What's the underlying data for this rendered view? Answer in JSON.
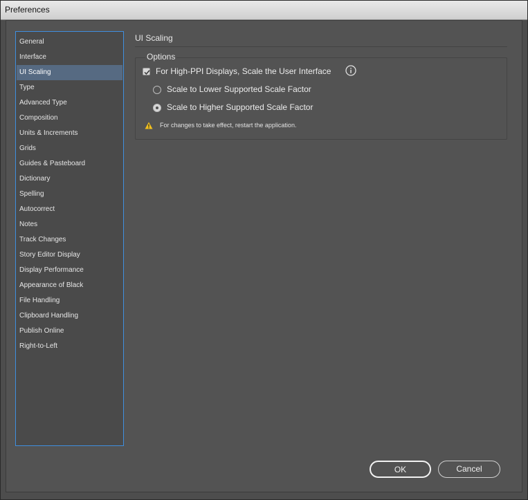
{
  "window": {
    "title": "Preferences"
  },
  "sidebar": {
    "items": [
      {
        "label": "General"
      },
      {
        "label": "Interface"
      },
      {
        "label": "UI Scaling",
        "selected": true
      },
      {
        "label": "Type"
      },
      {
        "label": "Advanced Type"
      },
      {
        "label": "Composition"
      },
      {
        "label": "Units & Increments"
      },
      {
        "label": "Grids"
      },
      {
        "label": "Guides & Pasteboard"
      },
      {
        "label": "Dictionary"
      },
      {
        "label": "Spelling"
      },
      {
        "label": "Autocorrect"
      },
      {
        "label": "Notes"
      },
      {
        "label": "Track Changes"
      },
      {
        "label": "Story Editor Display"
      },
      {
        "label": "Display Performance"
      },
      {
        "label": "Appearance of Black"
      },
      {
        "label": "File Handling"
      },
      {
        "label": "Clipboard Handling"
      },
      {
        "label": "Publish Online"
      },
      {
        "label": "Right-to-Left"
      }
    ]
  },
  "main": {
    "section_title": "UI Scaling",
    "options_legend": "Options",
    "scale_ui_checkbox": {
      "label": "For High-PPI Displays, Scale the User Interface",
      "checked": true
    },
    "radio_lower": {
      "label": "Scale to Lower Supported Scale Factor",
      "checked": false
    },
    "radio_higher": {
      "label": "Scale to Higher Supported Scale Factor",
      "checked": true
    },
    "warning_text": "For changes to take effect, restart the application."
  },
  "buttons": {
    "ok": "OK",
    "cancel": "Cancel"
  },
  "icons": {
    "info": "info-icon",
    "warning": "warning-icon",
    "checkmark": "checkmark-icon"
  },
  "colors": {
    "accent": "#3f8fe0",
    "selected_item": "#566a82",
    "warning": "#f2c01e"
  }
}
